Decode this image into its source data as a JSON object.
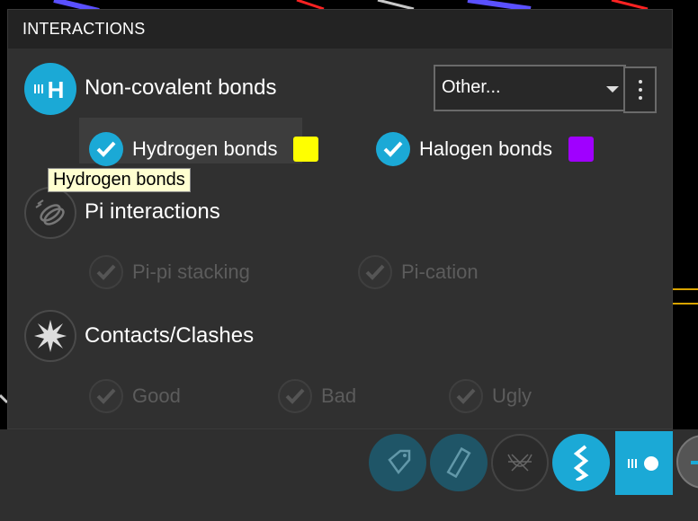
{
  "panel": {
    "title": "INTERACTIONS"
  },
  "noncovalent": {
    "title": "Non-covalent bonds",
    "icon": "hydrogen-h-icon",
    "filter_select": "Other...",
    "options": [
      {
        "label": "Hydrogen bonds",
        "checked": true,
        "color": "#ffff00"
      },
      {
        "label": "Halogen bonds",
        "checked": true,
        "color": "#a000ff"
      }
    ]
  },
  "tooltip": {
    "text": "Hydrogen bonds"
  },
  "pi": {
    "title": "Pi interactions",
    "icon": "pi-rings-icon",
    "options": [
      {
        "label": "Pi-pi stacking",
        "checked": false
      },
      {
        "label": "Pi-cation",
        "checked": false
      }
    ]
  },
  "contacts": {
    "title": "Contacts/Clashes",
    "icon": "starburst-icon",
    "options": [
      {
        "label": "Good",
        "checked": false
      },
      {
        "label": "Bad",
        "checked": false
      },
      {
        "label": "Ugly",
        "checked": false
      }
    ]
  },
  "toolbar": {
    "buttons": [
      "tag-icon",
      "ruler-icon",
      "mesh-icon",
      "helix-icon",
      "interactions-toggle-icon",
      "partial-icon"
    ]
  },
  "colors": {
    "accent": "#1ba9d6",
    "hydrogen": "#ffff00",
    "halogen": "#a000ff"
  }
}
